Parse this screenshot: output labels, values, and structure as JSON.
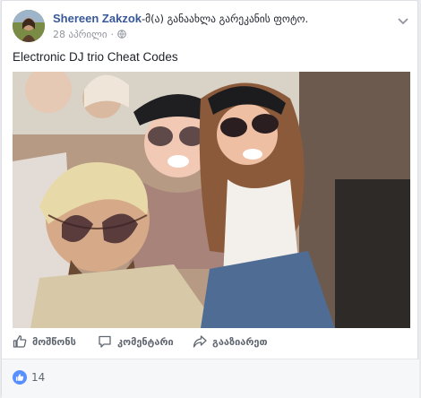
{
  "post": {
    "author": "Shereen Zakzok",
    "action": "-მ(ა) განაახლა გარეკანის ფოტო.",
    "date": "28 აპრილი",
    "meta_separator": "·",
    "text": "Electronic DJ trio Cheat Codes"
  },
  "actions": {
    "like_label": "მოშწონს",
    "comment_label": "კომენტარი",
    "share_label": "გააზიარეთ"
  },
  "reactions": {
    "count": "14"
  },
  "colors": {
    "author_link": "#385898",
    "like_badge": "#5890ff",
    "background": "#e9ebee"
  }
}
